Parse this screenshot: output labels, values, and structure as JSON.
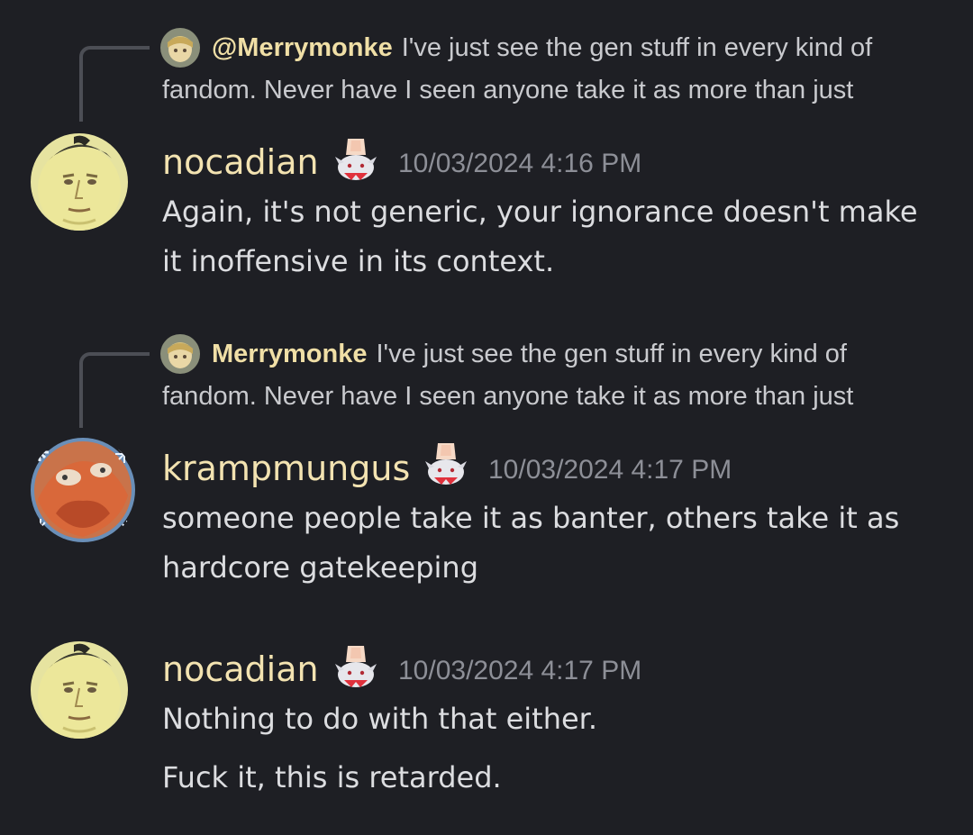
{
  "messages": [
    {
      "reply": {
        "mention": "@Merrymonke",
        "line1": "I've just see the gen stuff in every kind of",
        "line2": "fandom. Never have I seen anyone take it as more than just"
      },
      "username": "nocadian",
      "timestamp": "10/03/2024 4:16 PM",
      "lines": [
        "Again, it's not generic, your ignorance doesn't make",
        "it inoffensive in its context."
      ]
    },
    {
      "reply": {
        "mention": "Merrymonke",
        "line1": "I've just see the gen stuff in every kind of",
        "line2": "fandom. Never have I seen anyone take it as more than just"
      },
      "username": "krampmungus",
      "timestamp": "10/03/2024 4:17 PM",
      "lines": [
        "someone people take it as banter, others take it as",
        "hardcore gatekeeping"
      ]
    },
    {
      "username": "nocadian",
      "timestamp": "10/03/2024 4:17 PM",
      "lines": [
        "Nothing to do with that either.",
        "Fuck it, this is retarded."
      ]
    }
  ],
  "colors": {
    "background": "#1e1f24",
    "username": "#f3e3b1",
    "reply_name": "#f0dfa6",
    "text": "#dcdde0",
    "timestamp": "#8d8f97"
  },
  "icons": [
    "reply-spine",
    "mini-avatar",
    "user-avatar",
    "role-badge-icon"
  ]
}
